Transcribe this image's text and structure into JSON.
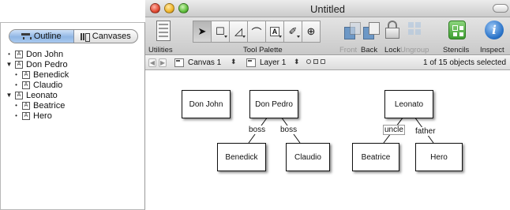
{
  "window": {
    "title": "Untitled"
  },
  "drawer": {
    "tabs": [
      {
        "label": "Outline",
        "icon": "outline-icon",
        "active": true
      },
      {
        "label": "Canvases",
        "icon": "canvases-icon",
        "active": false
      }
    ],
    "items": [
      {
        "label": "Don John",
        "level": 0,
        "marker": "•"
      },
      {
        "label": "Don Pedro",
        "level": 0,
        "marker": "▼"
      },
      {
        "label": "Benedick",
        "level": 1,
        "marker": "•"
      },
      {
        "label": "Claudio",
        "level": 1,
        "marker": "•"
      },
      {
        "label": "Leonato",
        "level": 0,
        "marker": "▼"
      },
      {
        "label": "Beatrice",
        "level": 1,
        "marker": "•"
      },
      {
        "label": "Hero",
        "level": 1,
        "marker": "•"
      }
    ],
    "type_badge": "A"
  },
  "toolbar": {
    "utilities": "Utilities",
    "tool_palette": "Tool Palette",
    "front": "Front",
    "back": "Back",
    "lock": "Lock",
    "ungroup": "Ungroup",
    "stencils": "Stencils",
    "inspect": "Inspect",
    "tool_text_glyph": "A"
  },
  "subbar": {
    "canvas": "Canvas 1",
    "layer": "Layer 1",
    "updown": "⬍",
    "status": "1 of 15 objects selected"
  },
  "diagram": {
    "nodes": {
      "don_john": "Don John",
      "don_pedro": "Don Pedro",
      "benedick": "Benedick",
      "claudio": "Claudio",
      "leonato": "Leonato",
      "beatrice": "Beatrice",
      "hero": "Hero"
    },
    "edges": {
      "pedro_benedick": "boss",
      "pedro_claudio": "boss",
      "leonato_beatrice": "uncle",
      "leonato_hero": "father"
    }
  },
  "colors": {
    "selected_tab": "#8fb6e4",
    "stencils": "#3e9d31",
    "inspect": "#2a73c8",
    "front_back": "#6d98c6"
  }
}
